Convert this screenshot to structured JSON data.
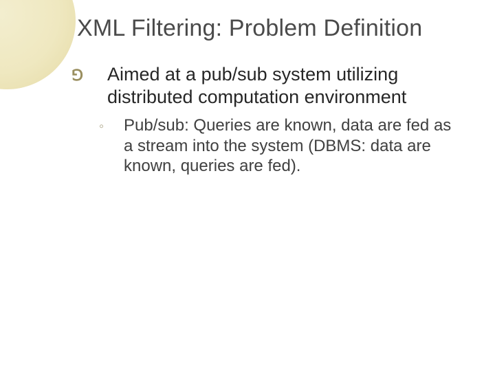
{
  "slide": {
    "title": "XML Filtering: Problem Definition",
    "bullet1": {
      "icon_name": "script-bullet-icon",
      "text": "Aimed at a pub/sub system utilizing distributed computation environment"
    },
    "sub1": {
      "icon_name": "ring-bullet-icon",
      "text": "Pub/sub: Queries are known, data are fed as a stream into the system (DBMS: data are known, queries are fed)."
    }
  }
}
